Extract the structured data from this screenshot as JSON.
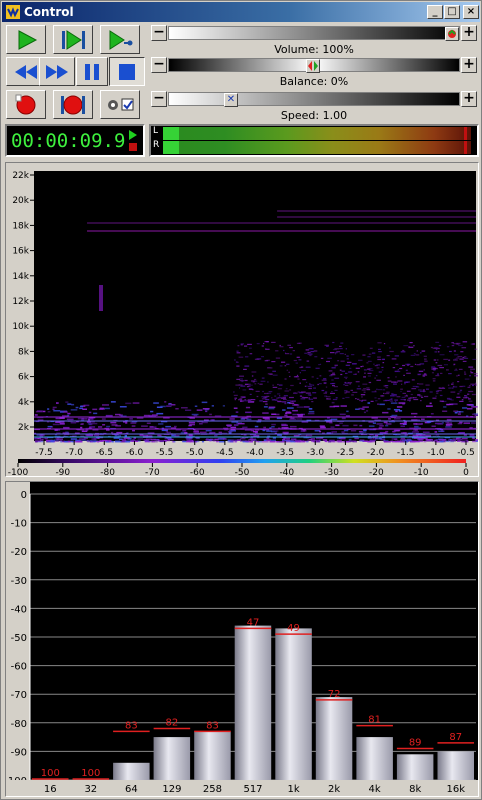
{
  "window": {
    "title": "Control",
    "min": "_",
    "max": "□",
    "close": "×"
  },
  "transport": {
    "play": "play",
    "play_selection": "play-selection",
    "play_cursor": "play-from-cursor",
    "rewind": "rewind",
    "fast_forward": "fast-forward",
    "pause": "pause",
    "stop": "stop",
    "record": "record",
    "record_new": "record-new"
  },
  "sliders": {
    "volume": {
      "label": "Volume: 100%",
      "value": 1.0
    },
    "balance": {
      "label": "Balance: 0%",
      "value": 0.5
    },
    "speed": {
      "label": "Speed: 1.00",
      "value": 0.24
    }
  },
  "time": {
    "value": "00:00:09.9"
  },
  "meter": {
    "left": "L",
    "right": "R"
  },
  "spectrogram": {
    "y_labels": [
      "22k",
      "20k",
      "18k",
      "16k",
      "14k",
      "12k",
      "10k",
      "8k",
      "6k",
      "4k",
      "2k"
    ],
    "x_labels": [
      "-7.5",
      "-7.0",
      "-6.5",
      "-6.0",
      "-5.5",
      "-5.0",
      "-4.5",
      "-4.0",
      "-3.5",
      "-3.0",
      "-2.5",
      "-2.0",
      "-1.5",
      "-1.0",
      "-0.5"
    ],
    "scale_labels": [
      "-100",
      "-90",
      "-80",
      "-70",
      "-60",
      "-50",
      "-40",
      "-30",
      "-20",
      "-10",
      "0"
    ]
  },
  "chart_data": {
    "type": "bar",
    "categories": [
      "16",
      "32",
      "64",
      "129",
      "258",
      "517",
      "1k",
      "2k",
      "4k",
      "8k",
      "16k"
    ],
    "values": [
      -100,
      -100,
      -94,
      -85,
      -83,
      -46,
      -47,
      -71,
      -85,
      -91,
      -90
    ],
    "peaks": [
      -100,
      -100,
      -83,
      -82,
      -83,
      -47,
      -49,
      -72,
      -81,
      -89,
      -87
    ],
    "peak_labels": [
      "100",
      "100",
      "83",
      "82",
      "83",
      "47",
      "49",
      "72",
      "81",
      "89",
      "87"
    ],
    "y_ticks": [
      "0",
      "-10",
      "-20",
      "-30",
      "-40",
      "-50",
      "-60",
      "-70",
      "-80",
      "-90",
      "100"
    ],
    "ylim": [
      -100,
      0
    ],
    "grid": true
  }
}
